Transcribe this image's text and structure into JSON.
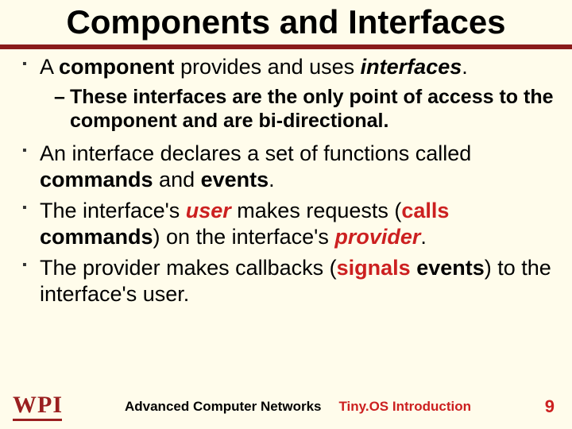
{
  "title": "Components and Interfaces",
  "bullets": {
    "b1_pre": "A ",
    "b1_comp": "component",
    "b1_mid": " provides and uses ",
    "b1_intf": "interfaces",
    "b1_post": ".",
    "s1": "These interfaces are the only point of access to the component and are bi-directional.",
    "b2_pre": "An interface declares a set of functions called ",
    "b2_cmd": "commands",
    "b2_and": " and ",
    "b2_evt": "events",
    "b2_post": ".",
    "b3_pre": "The interface's ",
    "b3_user": "user",
    "b3_mid1": " makes requests (",
    "b3_calls": "calls",
    "b3_sp": " ",
    "b3_cmds": "commands",
    "b3_mid2": ") on the interface's ",
    "b3_prov": "provider",
    "b3_post": ".",
    "b4_pre": "The provider makes callbacks (",
    "b4_sig": "signals",
    "b4_sp": " ",
    "b4_evts": "events",
    "b4_post": ") to the interface's user."
  },
  "footer": {
    "logo_w": "W",
    "logo_p": "P",
    "logo_i": "I",
    "center1": "Advanced Computer Networks",
    "center2": "Tiny.OS Introduction",
    "page": "9"
  }
}
